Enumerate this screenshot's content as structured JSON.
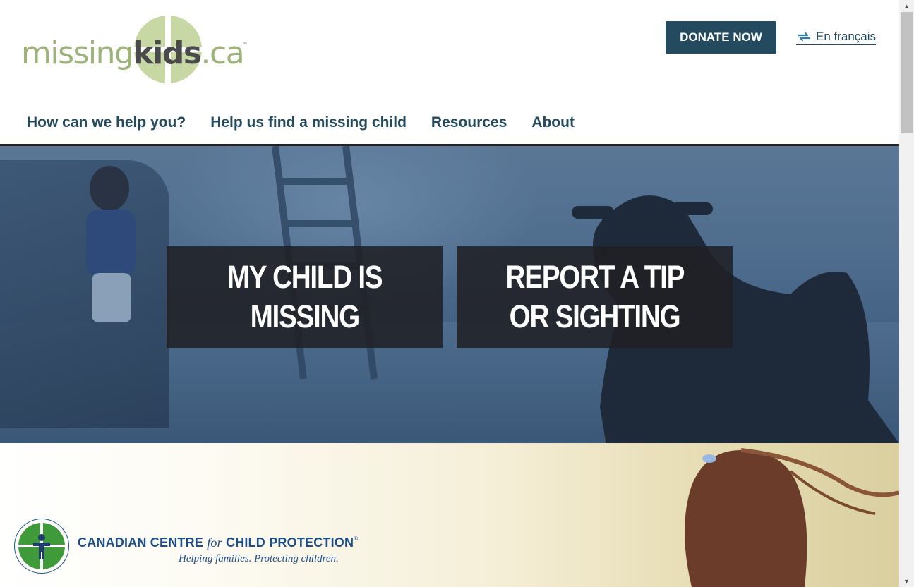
{
  "header": {
    "logo": {
      "part1": "missing",
      "part2": "kids",
      "part3": ".ca",
      "tm": "™"
    },
    "donate_label": "DONATE NOW",
    "language_label": "En français",
    "language_icon": "language-switch-icon"
  },
  "nav": {
    "items": [
      {
        "label": "How can we help you?"
      },
      {
        "label": "Help us find a missing child"
      },
      {
        "label": "Resources"
      },
      {
        "label": "About"
      }
    ]
  },
  "hero": {
    "cta_missing": {
      "line1": "MY CHILD IS",
      "line2": "MISSING"
    },
    "cta_tip": {
      "line1": "REPORT A TIP",
      "line2": "OR SIGHTING"
    }
  },
  "footer_band": {
    "org_name_a": "CANADIAN CENTRE ",
    "org_name_for": "for",
    "org_name_b": " CHILD PROTECTION",
    "org_reg": "®",
    "tagline": "Helping families. Protecting children."
  },
  "scrollbar": {
    "up_icon": "scroll-up-arrow-icon",
    "down_icon": "scroll-down-arrow-icon"
  },
  "colors": {
    "brand_navy": "#234a5f",
    "logo_green": "#9db37a",
    "ccp_blue": "#1d4e8c",
    "ccp_green": "#3f9a3a",
    "cta_bg": "#202024"
  }
}
